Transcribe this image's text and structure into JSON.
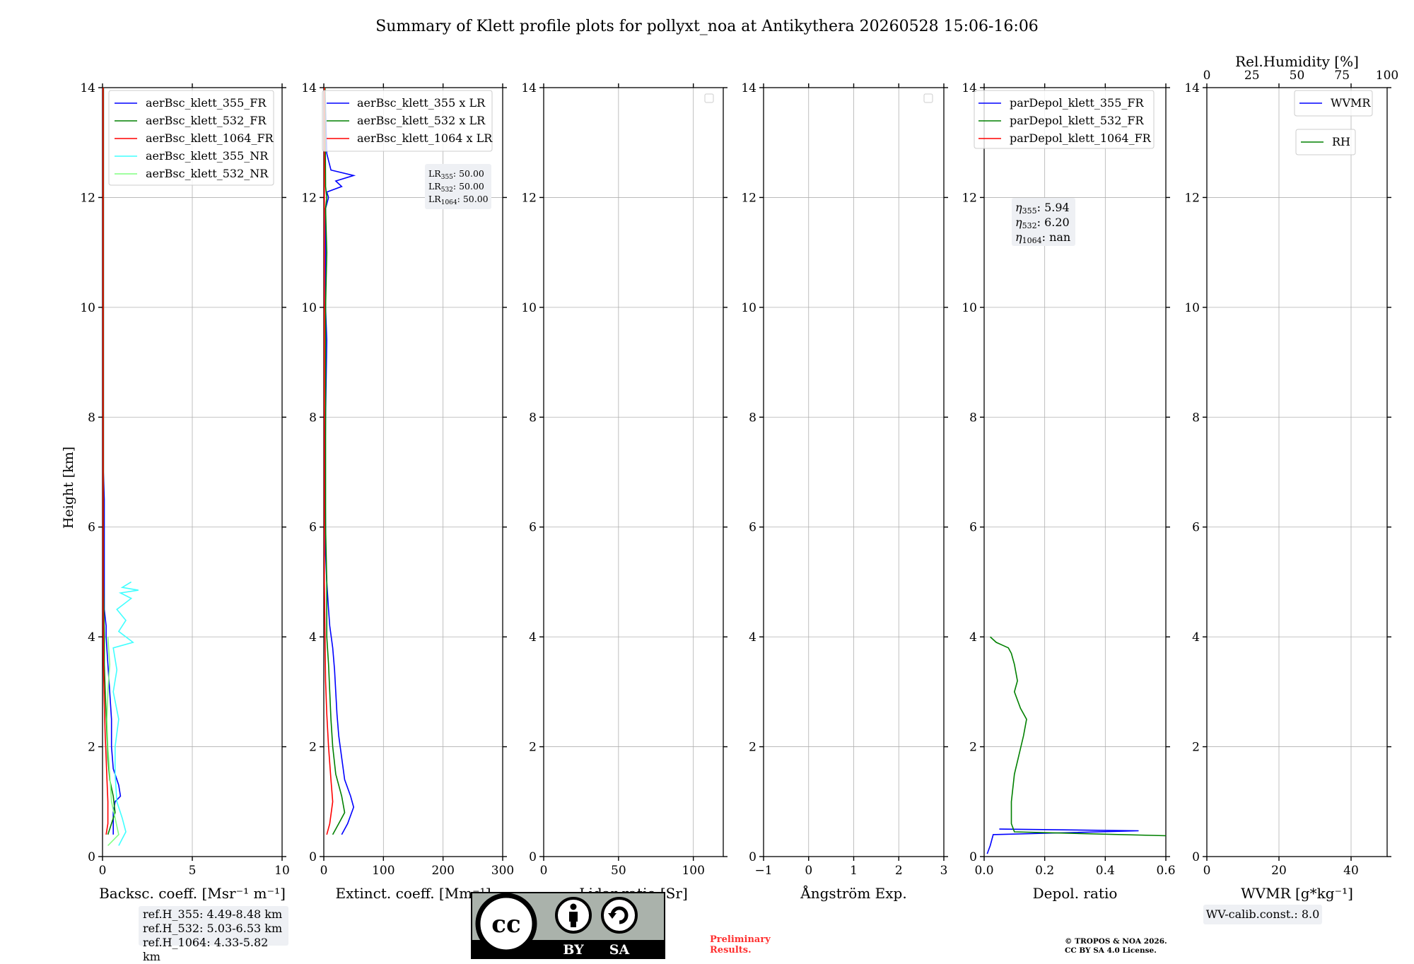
{
  "title": "Summary of Klett profile plots for pollyxt_noa at Antikythera 20260528 15:06-16:06",
  "ylabel": "Height [km]",
  "y_ticks": [
    "0",
    "2",
    "4",
    "6",
    "8",
    "10",
    "12",
    "14"
  ],
  "panels": [
    {
      "name": "backscatter",
      "xlabel": "Backsc. coeff. [Msr⁻¹ m⁻¹]",
      "xticks": [
        "0",
        "5",
        "10"
      ],
      "legend": [
        {
          "label": "aerBsc_klett_355_FR",
          "color": "#0000ff"
        },
        {
          "label": "aerBsc_klett_532_FR",
          "color": "#008000"
        },
        {
          "label": "aerBsc_klett_1064_FR",
          "color": "#ff0000"
        },
        {
          "label": "aerBsc_klett_355_NR",
          "color": "#40ffff"
        },
        {
          "label": "aerBsc_klett_532_NR",
          "color": "#80ff80"
        }
      ]
    },
    {
      "name": "extinction",
      "xlabel": "Extinct. coeff. [Mm⁻¹]",
      "xticks": [
        "0",
        "100",
        "200",
        "300"
      ],
      "legend": [
        {
          "label": "aerBsc_klett_355 x LR",
          "color": "#0000ff"
        },
        {
          "label": "aerBsc_klett_532 x LR",
          "color": "#008000"
        },
        {
          "label": "aerBsc_klett_1064 x LR",
          "color": "#ff0000"
        }
      ],
      "lr_box": [
        {
          "sub": "355",
          "value": "50.00"
        },
        {
          "sub": "532",
          "value": "50.00"
        },
        {
          "sub": "1064",
          "value": "50.00"
        }
      ]
    },
    {
      "name": "lidar-ratio",
      "xlabel": "Lidar ratio [Sr]",
      "xticks": [
        "0",
        "50",
        "100"
      ]
    },
    {
      "name": "angstrom",
      "xlabel": "Ångström Exp.",
      "xticks": [
        "−1",
        "0",
        "1",
        "2",
        "3"
      ]
    },
    {
      "name": "depol",
      "xlabel": "Depol. ratio",
      "xticks": [
        "0.0",
        "0.2",
        "0.4",
        "0.6"
      ],
      "legend": [
        {
          "label": "parDepol_klett_355_FR",
          "color": "#0000ff"
        },
        {
          "label": "parDepol_klett_532_FR",
          "color": "#008000"
        },
        {
          "label": "parDepol_klett_1064_FR",
          "color": "#ff0000"
        }
      ],
      "eta_box": [
        {
          "sub": "355",
          "value": "5.94"
        },
        {
          "sub": "532",
          "value": "6.20"
        },
        {
          "sub": "1064",
          "value": "nan"
        }
      ]
    },
    {
      "name": "wvmr",
      "xlabel": "WVMR [g*kg⁻¹]",
      "xticks": [
        "0",
        "20",
        "40"
      ],
      "top_label": "Rel.Humidity [%]",
      "top_ticks": [
        "0",
        "25",
        "50",
        "75",
        "100"
      ],
      "legend_wvmr": {
        "label": "WVMR",
        "color": "#0000ff"
      },
      "legend_rh": {
        "label": "RH",
        "color": "#008000"
      }
    }
  ],
  "ref_heights": [
    "ref.H_355: 4.49-8.48 km",
    "ref.H_532: 5.03-6.53 km",
    "ref.H_1064: 4.33-5.82 km"
  ],
  "wv_calib": "WV-calib.const.: 8.0",
  "preliminary": [
    "Preliminary",
    "Results."
  ],
  "copyright": [
    "© TROPOS & NOA 2026.",
    "CC BY SA 4.0 License."
  ],
  "license_badge": {
    "by": "BY",
    "sa": "SA",
    "cc": "cc"
  },
  "chart_data": [
    {
      "type": "line",
      "panel": "backscatter",
      "xlim": [
        0,
        10
      ],
      "ylim": [
        0,
        14
      ],
      "grid": true,
      "legend": "top-left",
      "series": [
        {
          "name": "aerBsc_klett_355_FR",
          "color": "#0000ff",
          "x": [
            0.6,
            0.6,
            0.6,
            0.7,
            1.0,
            0.9,
            0.6,
            0.5,
            0.5,
            0.4,
            0.3,
            0.2,
            0.2,
            0.1,
            0.1,
            0.1,
            0.1,
            0.1,
            0.05,
            0.05,
            0.05,
            0.05,
            0.05,
            0.05,
            0.05,
            0.05,
            0.05,
            0.05,
            0.05,
            0.05,
            0.05
          ],
          "y": [
            0.4,
            0.6,
            0.8,
            1.0,
            1.1,
            1.3,
            1.6,
            2.0,
            2.5,
            3.0,
            3.5,
            4.0,
            4.2,
            4.5,
            5.0,
            5.5,
            6.0,
            6.5,
            7.0,
            7.5,
            8.0,
            8.5,
            9.0,
            9.5,
            10.0,
            10.5,
            11.0,
            11.5,
            12.0,
            13.0,
            14.0
          ]
        },
        {
          "name": "aerBsc_klett_532_FR",
          "color": "#008000",
          "x": [
            0.3,
            0.5,
            0.7,
            0.6,
            0.4,
            0.3,
            0.25,
            0.2,
            0.15,
            0.1,
            0.1,
            0.05,
            0.05,
            0.05,
            0.05,
            0.05,
            0.05,
            0.05,
            0.05,
            0.05
          ],
          "y": [
            0.4,
            0.6,
            0.8,
            1.1,
            1.4,
            1.8,
            2.2,
            2.6,
            3.0,
            3.5,
            4.0,
            5.0,
            6.0,
            7.0,
            8.0,
            9.0,
            10.0,
            11.0,
            12.0,
            14.0
          ]
        },
        {
          "name": "aerBsc_klett_1064_FR",
          "color": "#ff0000",
          "x": [
            0.2,
            0.3,
            0.3,
            0.25,
            0.2,
            0.15,
            0.1,
            0.05,
            0.03,
            0.03,
            0.03,
            0.03,
            0.03,
            0.03,
            0.03
          ],
          "y": [
            0.4,
            0.6,
            1.0,
            1.4,
            1.8,
            2.2,
            2.8,
            3.5,
            4.5,
            6.0,
            8.0,
            10.0,
            11.0,
            12.0,
            14.0
          ]
        },
        {
          "name": "aerBsc_klett_355_NR",
          "color": "#40ffff",
          "x": [
            0.9,
            1.3,
            1.1,
            0.8,
            0.7,
            0.7,
            0.9,
            0.6,
            0.8,
            0.6,
            1.7,
            0.9,
            1.3,
            0.8,
            1.6,
            1.0,
            2.0,
            1.1,
            1.6
          ],
          "y": [
            0.2,
            0.45,
            0.7,
            1.0,
            1.5,
            2.0,
            2.5,
            3.0,
            3.4,
            3.8,
            3.9,
            4.1,
            4.3,
            4.5,
            4.7,
            4.8,
            4.85,
            4.9,
            5.0
          ]
        },
        {
          "name": "aerBsc_klett_532_NR",
          "color": "#80ff80",
          "x": [
            0.3,
            0.9,
            0.7,
            0.5,
            0.4,
            0.3,
            0.25,
            0.3,
            0.4,
            0.3
          ],
          "y": [
            0.2,
            0.4,
            0.7,
            1.0,
            1.5,
            2.0,
            2.5,
            3.0,
            3.5,
            4.0
          ]
        }
      ]
    },
    {
      "type": "line",
      "panel": "extinction",
      "xlim": [
        0,
        300
      ],
      "ylim": [
        0,
        14
      ],
      "grid": true,
      "legend": "top-left",
      "series": [
        {
          "name": "aerBsc_klett_355 x LR",
          "color": "#0000ff",
          "x": [
            30,
            40,
            50,
            45,
            35,
            30,
            25,
            22,
            20,
            18,
            15,
            10,
            8,
            5,
            3,
            3,
            2,
            3,
            5,
            3,
            3,
            3,
            8,
            5,
            30,
            20,
            50,
            12,
            5,
            2
          ],
          "y": [
            0.4,
            0.6,
            0.9,
            1.1,
            1.4,
            1.8,
            2.2,
            2.6,
            3.0,
            3.4,
            3.8,
            4.2,
            4.5,
            5.0,
            5.5,
            6.0,
            7.0,
            8.0,
            9.4,
            10.0,
            11.0,
            11.8,
            12.0,
            12.1,
            12.2,
            12.3,
            12.4,
            12.5,
            12.8,
            14.0
          ]
        },
        {
          "name": "aerBsc_klett_532 x LR",
          "color": "#008000",
          "x": [
            15,
            25,
            35,
            30,
            20,
            15,
            12,
            10,
            8,
            5,
            5,
            3,
            3,
            3,
            3,
            3,
            5,
            3,
            5,
            3,
            2
          ],
          "y": [
            0.4,
            0.6,
            0.8,
            1.1,
            1.5,
            2.0,
            2.5,
            3.0,
            3.5,
            4.0,
            5.0,
            6.0,
            7.0,
            8.0,
            9.0,
            10.0,
            11.0,
            11.8,
            12.0,
            12.2,
            14.0
          ]
        },
        {
          "name": "aerBsc_klett_1064 x LR",
          "color": "#ff0000",
          "x": [
            5,
            10,
            15,
            12,
            8,
            5,
            3,
            2,
            1,
            1,
            1,
            1,
            1,
            1
          ],
          "y": [
            0.4,
            0.6,
            1.0,
            1.4,
            2.0,
            2.6,
            3.2,
            4.0,
            5.0,
            7.0,
            9.0,
            11.0,
            12.0,
            14.0
          ]
        }
      ]
    },
    {
      "type": "line",
      "panel": "lidar-ratio",
      "xlim": [
        0,
        120
      ],
      "ylim": [
        0,
        14
      ],
      "grid": true,
      "series": []
    },
    {
      "type": "line",
      "panel": "angstrom",
      "xlim": [
        -1,
        3
      ],
      "ylim": [
        0,
        14
      ],
      "grid": true,
      "series": []
    },
    {
      "type": "line",
      "panel": "depol",
      "xlim": [
        0,
        0.6
      ],
      "ylim": [
        0,
        14
      ],
      "grid": true,
      "legend": "top-left",
      "series": [
        {
          "name": "parDepol_klett_355_FR",
          "color": "#0000ff",
          "x": [
            0.01,
            0.02,
            0.03,
            0.51,
            0.05
          ],
          "y": [
            0.05,
            0.2,
            0.4,
            0.47,
            0.5
          ]
        },
        {
          "name": "parDepol_klett_532_FR",
          "color": "#008000",
          "x": [
            0.6,
            0.1,
            0.09,
            0.09,
            0.1,
            0.13,
            0.14,
            0.12,
            0.1,
            0.11,
            0.1,
            0.09,
            0.08,
            0.06,
            0.04,
            0.02
          ],
          "y": [
            0.38,
            0.45,
            0.6,
            1.0,
            1.5,
            2.2,
            2.5,
            2.7,
            3.0,
            3.2,
            3.5,
            3.7,
            3.8,
            3.85,
            3.9,
            4.0
          ]
        }
      ]
    },
    {
      "type": "line",
      "panel": "wvmr",
      "xlim": [
        0,
        50
      ],
      "ylim": [
        0,
        14
      ],
      "top_xlim": [
        0,
        100
      ],
      "grid": true,
      "legend": "top-right",
      "series": []
    }
  ]
}
